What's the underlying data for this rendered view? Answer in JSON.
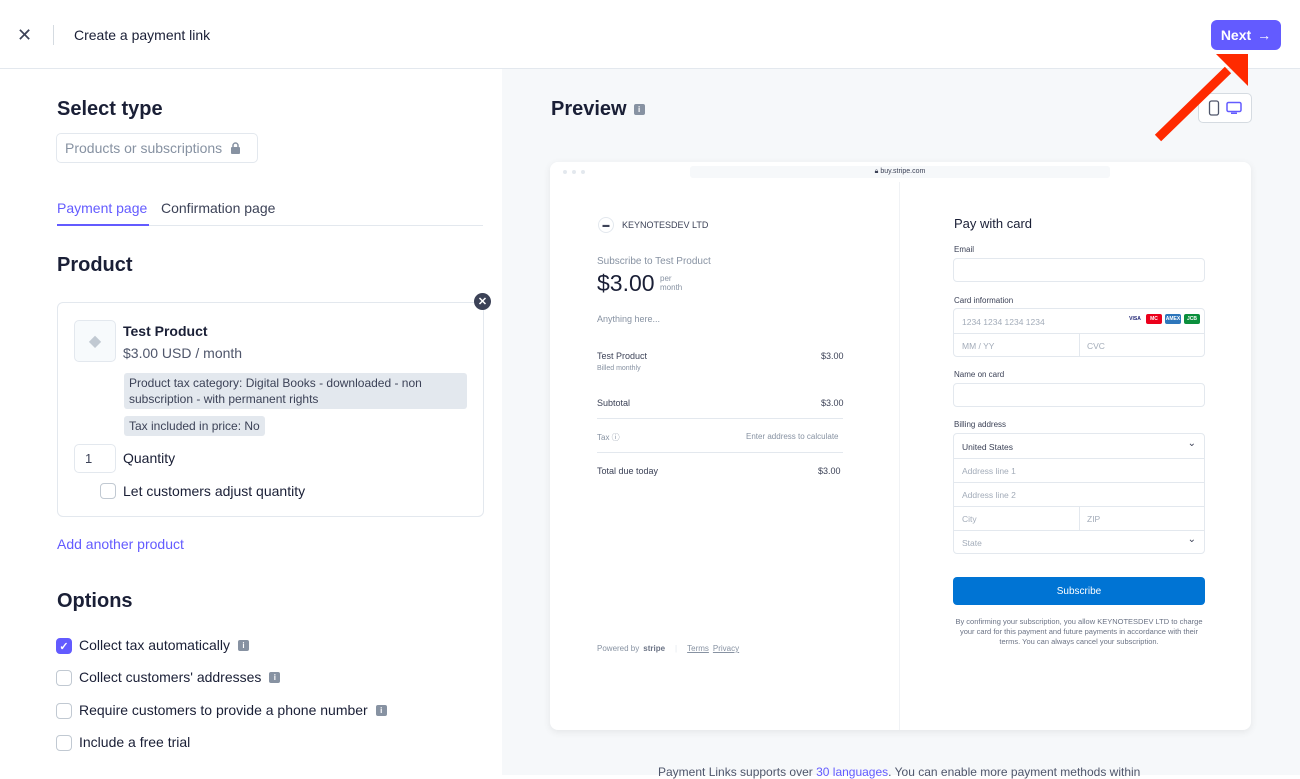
{
  "header": {
    "title": "Create a payment link",
    "next_label": "Next"
  },
  "select_type": {
    "heading": "Select type",
    "type_value": "Products or subscriptions"
  },
  "tabs": [
    {
      "label": "Payment page",
      "active": true
    },
    {
      "label": "Confirmation page",
      "active": false
    }
  ],
  "product_section": {
    "heading": "Product",
    "product": {
      "name": "Test Product",
      "price": "$3.00 USD / month",
      "tax_category": "Product tax category: Digital Books - downloaded - non subscription - with permanent rights",
      "tax_included": "Tax included in price: No",
      "quantity": "1",
      "quantity_label": "Quantity",
      "adjust_quantity_label": "Let customers adjust quantity",
      "adjust_quantity_checked": false
    },
    "add_another": "Add another product"
  },
  "options": {
    "heading": "Options",
    "items": [
      {
        "label": "Collect tax automatically",
        "checked": true,
        "info": true
      },
      {
        "label": "Collect customers' addresses",
        "checked": false,
        "info": true
      },
      {
        "label": "Require customers to provide a phone number",
        "checked": false,
        "info": true
      },
      {
        "label": "Include a free trial",
        "checked": false,
        "info": false
      }
    ]
  },
  "preview": {
    "heading": "Preview",
    "url": "buy.stripe.com",
    "merchant": "KEYNOTESDEV LTD",
    "subscribe_to": "Subscribe to Test Product",
    "amount": "$3.00",
    "per": "per",
    "month": "month",
    "description": "Anything here...",
    "line_item_name": "Test Product",
    "line_item_sub": "Billed monthly",
    "line_item_price": "$3.00",
    "subtotal_label": "Subtotal",
    "subtotal_value": "$3.00",
    "tax_label": "Tax ⓘ",
    "tax_value": "Enter address to calculate",
    "total_label": "Total due today",
    "total_value": "$3.00",
    "powered_by": "Powered by",
    "stripe": "stripe",
    "terms": "Terms",
    "privacy": "Privacy",
    "pay_heading": "Pay with card",
    "email_label": "Email",
    "card_label": "Card information",
    "card_placeholder": "1234 1234 1234 1234",
    "expiry_placeholder": "MM / YY",
    "cvc_placeholder": "CVC",
    "name_label": "Name on card",
    "billing_label": "Billing address",
    "country": "United States",
    "address1": "Address line 1",
    "address2": "Address line 2",
    "city": "City",
    "zip": "ZIP",
    "state": "State",
    "subscribe_label": "Subscribe",
    "fine_print": "By confirming your subscription, you allow KEYNOTESDEV LTD to charge your card for this payment and future payments in accordance with their terms. You can always cancel your subscription.",
    "card_brands": [
      "VISA",
      "MC",
      "AMEX",
      "JCB"
    ]
  },
  "footer": {
    "text_before": "Payment Links supports over",
    "link": "30 languages",
    "text_after": ". You can enable more payment methods within"
  },
  "colors": {
    "accent": "#635bff",
    "subscribe": "#0074d4",
    "annotation_arrow": "#ff2a00"
  }
}
